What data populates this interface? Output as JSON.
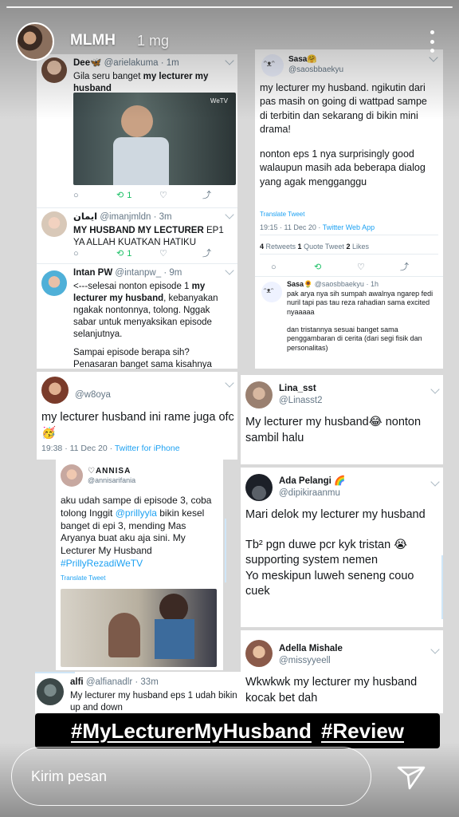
{
  "story": {
    "username": "MLMH",
    "time_ago": "1 mg",
    "message_placeholder": "Kirim pesan"
  },
  "tweets": {
    "dee": {
      "name": "Dee🦋",
      "handle": "@arielakuma",
      "time": "· 1m",
      "text_pre": "Gila seru banget ",
      "text_bold": "my lecturer my husband",
      "emoji": "😭😭",
      "video_logo": "WeTV",
      "retweets": "1"
    },
    "iman": {
      "name": "ايمان",
      "handle": "@imanjmldn",
      "time": "· 3m",
      "text_bold": "MY HUSBAND MY LECTURER",
      "text_rest": " EP1 YA ALLAH KUATKAN HATIKU",
      "retweets": "1"
    },
    "intan": {
      "name": "Intan PW",
      "handle": "@intanpw_",
      "time": "· 9m",
      "text_1": "<---selesai nonton episode 1 ",
      "text_bold": "my lecturer my husband",
      "text_2": ", kebanyakan ngakak nontonnya, tolong. Nggak sabar untuk menyaksikan episode selanjutnya.",
      "text_3": "Sampai episode berapa sih? Penasaran banget sama kisahnya Inggit & Pak Arya",
      "emoji": "😂😂"
    },
    "w8oya": {
      "handle": "@w8oya",
      "text": "my lecturer husband ini rame juga ofc 🥳",
      "meta_time": "19:38 · 11 Dec 20 · ",
      "meta_source": "Twitter for iPhone"
    },
    "annisa": {
      "name": "♡ANNISA",
      "handle": "@annisarifania",
      "text_1": "aku udah sampe di episode 3, coba tolong Inggit ",
      "mention": "@prillyyla",
      "text_2": " bikin kesel banget di epi 3, mending Mas Aryanya buat aku aja sini. My Lecturer My Husband ",
      "hashtag": "#PrillyRezadiWeTV",
      "translate": "Translate Tweet"
    },
    "alfi": {
      "name": "alfi",
      "handle": "@alfianadlr",
      "time": "· 33m",
      "text": "My lecturer my husband eps 1 udah bikin up and down"
    },
    "sasa": {
      "name": "Sasa🤗",
      "handle": "@saosbbaekyu",
      "text_1": "my lecturer my husband. ngikutin dari pas masih on going di wattpad sampe di terbitin dan sekarang di bikin mini drama!",
      "text_2": "nonton eps 1 nya surprisingly good walaupun masih ada beberapa dialog yang agak mengganggu",
      "translate": "Translate Tweet",
      "meta_time": "19:15 · 11 Dec 20 · ",
      "meta_source": "Twitter Web App",
      "retweets_n": "4",
      "retweets_label": " Retweets  ",
      "quote_n": "1",
      "quote_label": " Quote Tweet  ",
      "likes_n": "2",
      "likes_label": " Likes"
    },
    "sasa_reply": {
      "name": "Sasa🌻",
      "handle": "@saosbbaekyu",
      "time": "· 1h",
      "text_1": "pak arya nya sih sumpah awalnya ngarep fedi nuril tapi pas tau reza rahadian sama excited nyaaaaa",
      "text_2": "dan tristannya sesuai banget sama penggambaran di cerita (dari segi fisik dan personalitas)"
    },
    "lina": {
      "name": "Lina_sst",
      "handle": "@Linasst2",
      "text": "My lecturer my husband😂 nonton sambil halu"
    },
    "ada": {
      "name": "Ada Pelangi 🌈",
      "handle": "@dipikiraanmu",
      "text_1": "Mari delok my lecturer my husband",
      "text_2": "Tb² pgn duwe pcr kyk tristan 😭 supporting system nemen",
      "text_3": "Yo meskipun luweh seneng couo cuek"
    },
    "adella": {
      "name": "Adella Mishale",
      "handle": "@missyyeell",
      "text": "Wkwkwk my lecturer my husband kocak bet dah"
    }
  },
  "hashtags": [
    "#MyLecturerMyHusband",
    "#Review"
  ]
}
